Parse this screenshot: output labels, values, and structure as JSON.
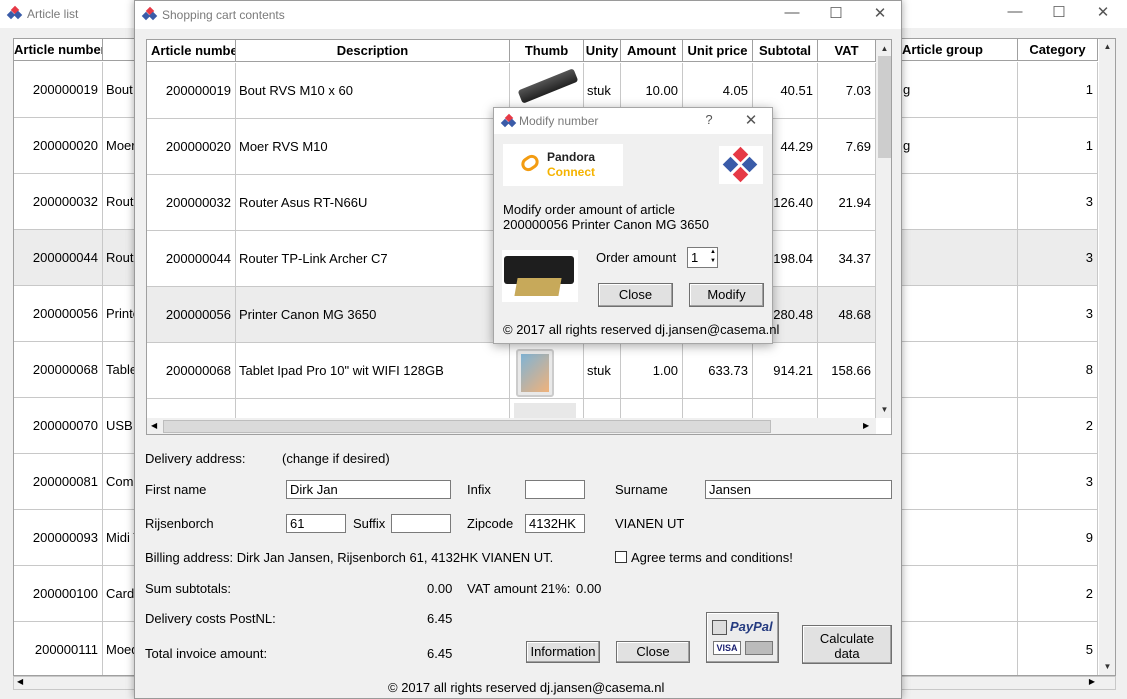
{
  "article_list": {
    "title": "Article list",
    "col_article_number": "Article number",
    "col_article_group": "Article group",
    "col_category": "Category",
    "rows": [
      {
        "number": "200000019",
        "desc": "Bout R",
        "group": "g",
        "category": "1"
      },
      {
        "number": "200000020",
        "desc": "Moer",
        "group": "g",
        "category": "1"
      },
      {
        "number": "200000032",
        "desc": "Route",
        "group": "",
        "category": "3"
      },
      {
        "number": "200000044",
        "desc": "Route",
        "group": "",
        "category": "3"
      },
      {
        "number": "200000056",
        "desc": "Printe",
        "group": "",
        "category": "3"
      },
      {
        "number": "200000068",
        "desc": "Tablet",
        "group": "",
        "category": "8"
      },
      {
        "number": "200000070",
        "desc": "USB I",
        "group": "",
        "category": "2"
      },
      {
        "number": "200000081",
        "desc": "Comp",
        "group": "",
        "category": "3"
      },
      {
        "number": "200000093",
        "desc": "Midi T",
        "group": "",
        "category": "9"
      },
      {
        "number": "200000100",
        "desc": "Cardr",
        "group": "",
        "category": "2"
      },
      {
        "number": "200000111",
        "desc": "Moed",
        "group": "",
        "category": "5"
      }
    ]
  },
  "cart": {
    "title": "Shopping cart contents",
    "columns": {
      "article_number": "Article number",
      "description": "Description",
      "thumb": "Thumb",
      "unity": "Unity",
      "amount": "Amount",
      "unit_price": "Unit price",
      "subtotal": "Subtotal",
      "vat": "VAT"
    },
    "rows": [
      {
        "number": "200000019",
        "description": "Bout RVS M10 x 60",
        "unity": "stuk",
        "amount": "10.00",
        "unit_price": "4.05",
        "subtotal": "40.51",
        "vat": "7.03"
      },
      {
        "number": "200000020",
        "description": "Moer RVS M10",
        "unity": "",
        "amount": "",
        "unit_price": "",
        "subtotal": "44.29",
        "vat": "7.69"
      },
      {
        "number": "200000032",
        "description": "Router Asus RT-N66U",
        "unity": "",
        "amount": "",
        "unit_price": "",
        "subtotal": "126.40",
        "vat": "21.94"
      },
      {
        "number": "200000044",
        "description": "Router TP-Link Archer C7",
        "unity": "",
        "amount": "",
        "unit_price": "",
        "subtotal": "198.04",
        "vat": "34.37"
      },
      {
        "number": "200000056",
        "description": "Printer Canon MG 3650",
        "unity": "",
        "amount": "",
        "unit_price": "",
        "subtotal": "280.48",
        "vat": "48.68"
      },
      {
        "number": "200000068",
        "description": "Tablet Ipad Pro 10\" wit WIFI 128GB",
        "unity": "stuk",
        "amount": "1.00",
        "unit_price": "633.73",
        "subtotal": "914.21",
        "vat": "158.66"
      }
    ],
    "delivery_address_label": "Delivery address:",
    "change_hint": "(change if desired)",
    "first_name_label": "First name",
    "first_name": "Dirk Jan",
    "infix_label": "Infix",
    "infix": "",
    "surname_label": "Surname",
    "surname": "Jansen",
    "street": "Rijsenborch",
    "house_number": "61",
    "suffix_label": "Suffix",
    "suffix": "",
    "zipcode_label": "Zipcode",
    "zipcode": "4132HK",
    "city": "VIANEN UT",
    "billing_address": "Billing address: Dirk Jan  Jansen,  Rijsenborch 61, 4132HK VIANEN UT.",
    "agree_label": "Agree terms and conditions!",
    "sum_subtotals_label": "Sum subtotals:",
    "sum_subtotals": "0.00",
    "vat_label": "VAT amount 21%:",
    "vat_amount": "0.00",
    "delivery_costs_label": "Delivery costs PostNL:",
    "delivery_costs": "6.45",
    "total_label": "Total invoice amount:",
    "total": "6.45",
    "information_button": "Information",
    "close_button": "Close",
    "calculate_button_line1": "Calculate",
    "calculate_button_line2": "data",
    "paypal": "PayPal",
    "visa": "VISA",
    "footer": "© 2017 all rights reserved dj.jansen@casema.nl"
  },
  "modify_dialog": {
    "title": "Modify number",
    "help": "?",
    "brand_line1": "Pandora",
    "brand_line2": "Connect",
    "message_line1": "Modify order amount of article",
    "message_line2": "200000056 Printer Canon MG 3650",
    "order_amount_label": "Order amount",
    "order_amount": "1",
    "close_button": "Close",
    "modify_button": "Modify",
    "footer": "© 2017 all rights reserved dj.jansen@casema.nl"
  },
  "colors": {
    "logo_red": "#e63946",
    "logo_blue": "#3a5ba8",
    "paypal_blue": "#253b80"
  }
}
